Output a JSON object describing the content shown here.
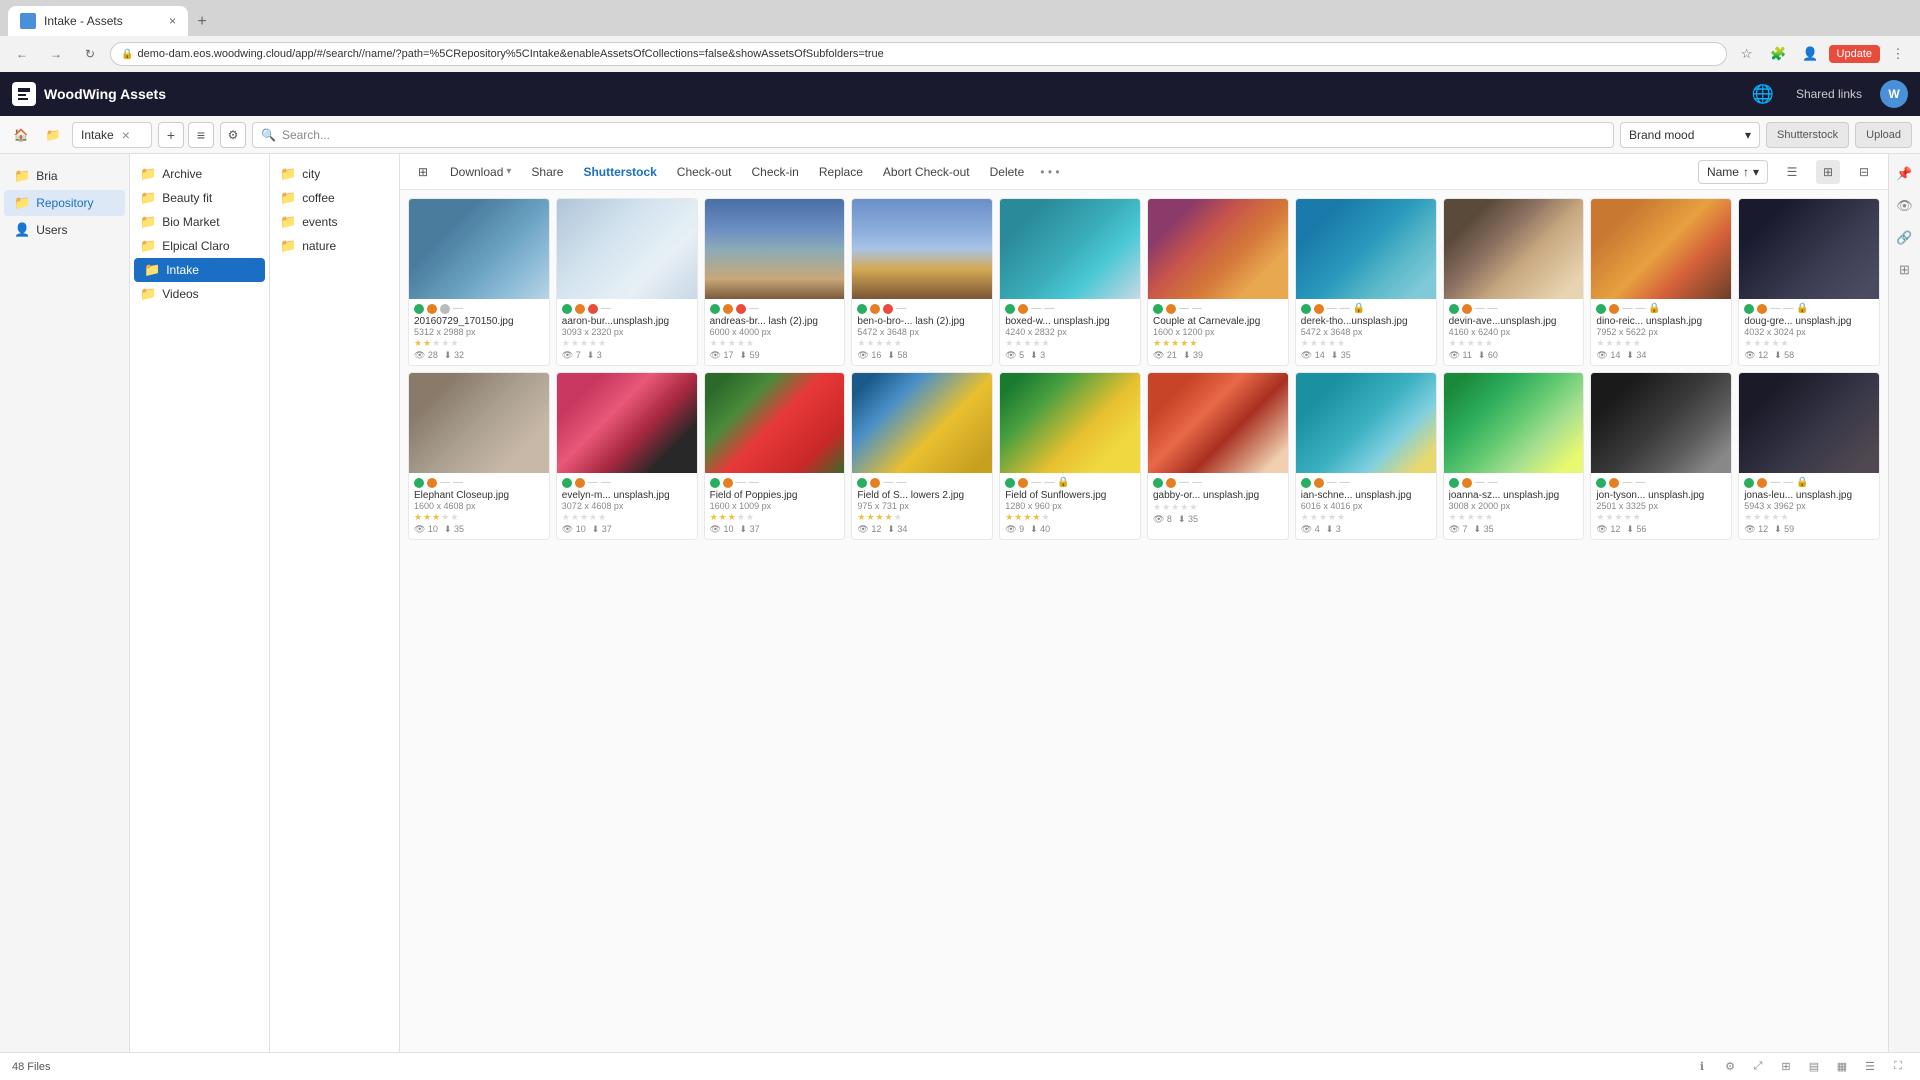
{
  "browser": {
    "tab_label": "Intake - Assets",
    "address": "demo-dam.eos.woodwing.cloud/app/#/search//name/?path=%5CRepository%5CIntake&enableAssetsOfCollections=false&showAssetsOfSubfolders=true",
    "update_btn": "Update"
  },
  "app": {
    "logo": "WoodWing Assets",
    "header_buttons": [
      "Shared links"
    ],
    "avatar_initials": "W"
  },
  "path_bar": {
    "breadcrumb": "Intake",
    "search_placeholder": "Search...",
    "collection_dropdown": "Brand mood",
    "shutterstock_btn": "Shutterstock",
    "upload_btn": "Upload"
  },
  "sidebar": {
    "items": [
      {
        "label": "Bria",
        "icon": "📁",
        "active": false
      },
      {
        "label": "Repository",
        "icon": "📁",
        "active": true
      },
      {
        "label": "Users",
        "icon": "👤",
        "active": false
      }
    ]
  },
  "folder_panel": {
    "items": [
      {
        "label": "Archive",
        "icon": "📁"
      },
      {
        "label": "Beauty fit",
        "icon": "📁"
      },
      {
        "label": "Bio Market",
        "icon": "📁"
      },
      {
        "label": "Elpical Claro",
        "icon": "📁"
      },
      {
        "label": "Intake",
        "icon": "📁",
        "active": true
      },
      {
        "label": "Videos",
        "icon": "📁"
      }
    ]
  },
  "subfolder_panel": {
    "items": [
      {
        "label": "city",
        "icon": "📁"
      },
      {
        "label": "coffee",
        "icon": "📁"
      },
      {
        "label": "events",
        "icon": "📁"
      },
      {
        "label": "nature",
        "icon": "📁"
      }
    ]
  },
  "toolbar": {
    "download_label": "Download",
    "share_label": "Share",
    "shutterstock_label": "Shutterstock",
    "checkout_label": "Check-out",
    "checkin_label": "Check-in",
    "replace_label": "Replace",
    "abort_label": "Abort Check-out",
    "delete_label": "Delete",
    "sort_label": "Name",
    "filter_label": "Filter"
  },
  "status_bar": {
    "file_count": "48 Files"
  },
  "assets": [
    {
      "name": "20160729_170150.jpg",
      "dims": "5312 x 2988 px",
      "views": 28,
      "downloads": 32,
      "stars": 2,
      "flags": [
        "green",
        "orange",
        "gray"
      ],
      "thumb": "thumb-boat"
    },
    {
      "name": "aaron-bur...unsplash.jpg",
      "dims": "3093 x 2320 px",
      "views": 7,
      "downloads": 3,
      "stars": 0,
      "flags": [
        "green",
        "orange",
        "red"
      ],
      "thumb": "thumb-snow"
    },
    {
      "name": "andreas-br... lash (2).jpg",
      "dims": "6000 x 4000 px",
      "views": 17,
      "downloads": 59,
      "stars": 0,
      "flags": [
        "green",
        "orange",
        "red"
      ],
      "thumb": "thumb-city"
    },
    {
      "name": "ben-o-bro-... lash (2).jpg",
      "dims": "5472 x 3648 px",
      "views": 16,
      "downloads": 58,
      "stars": 0,
      "flags": [
        "green",
        "orange",
        "red"
      ],
      "thumb": "thumb-skyline"
    },
    {
      "name": "boxed-w... unsplash.jpg",
      "dims": "4240 x 2832 px",
      "views": 5,
      "downloads": 3,
      "stars": 0,
      "flags": [
        "green",
        "orange"
      ],
      "thumb": "thumb-person-water"
    },
    {
      "name": "Couple at Carnevale.jpg",
      "dims": "1600 x 1200 px",
      "views": 21,
      "downloads": 39,
      "stars": 5,
      "flags": [
        "green",
        "orange"
      ],
      "thumb": "thumb-carnival"
    },
    {
      "name": "derek-tho...unsplash.jpg",
      "dims": "5472 x 3648 px",
      "views": 14,
      "downloads": 35,
      "stars": 0,
      "flags": [
        "green",
        "orange"
      ],
      "thumb": "thumb-pool",
      "badge": "🔒"
    },
    {
      "name": "devin-ave...unsplash.jpg",
      "dims": "4160 x 6240 px",
      "views": 11,
      "downloads": 60,
      "stars": 0,
      "flags": [
        "green",
        "orange"
      ],
      "thumb": "thumb-coffee"
    },
    {
      "name": "dino-reic... unsplash.jpg",
      "dims": "7952 x 5622 px",
      "views": 14,
      "downloads": 34,
      "stars": 0,
      "flags": [
        "green",
        "orange"
      ],
      "thumb": "thumb-car-canyon",
      "badge": "🔒"
    },
    {
      "name": "doug-gre... unsplash.jpg",
      "dims": "4032 x 3024 px",
      "views": 12,
      "downloads": 58,
      "stars": 0,
      "flags": [
        "green",
        "orange"
      ],
      "thumb": "thumb-dark-room",
      "badge": "🔒"
    },
    {
      "name": "Elephant Closeup.jpg",
      "dims": "1600 x 4608 px",
      "views": 10,
      "downloads": 35,
      "stars": 3,
      "flags": [
        "green",
        "orange"
      ],
      "thumb": "thumb-elephant"
    },
    {
      "name": "evelyn-m... unsplash.jpg",
      "dims": "3072 x 4608 px",
      "views": 10,
      "downloads": 37,
      "stars": 0,
      "flags": [
        "green",
        "orange"
      ],
      "thumb": "thumb-woman-flowers"
    },
    {
      "name": "Field of Poppies.jpg",
      "dims": "1600 x 1009 px",
      "views": 10,
      "downloads": 37,
      "stars": 3,
      "flags": [
        "green",
        "orange"
      ],
      "thumb": "thumb-poppies"
    },
    {
      "name": "Field of S... lowers 2.jpg",
      "dims": "975 x 731 px",
      "views": 12,
      "downloads": 34,
      "stars": 4,
      "flags": [
        "green",
        "orange"
      ],
      "thumb": "thumb-sunflower"
    },
    {
      "name": "Field of Sunflowers.jpg",
      "dims": "1280 x 960 px",
      "views": 9,
      "downloads": 40,
      "stars": 4,
      "flags": [
        "green",
        "orange"
      ],
      "thumb": "thumb-sunflowers2",
      "badge": "🔒"
    },
    {
      "name": "gabby-or... unsplash.jpg",
      "dims": "",
      "views": 8,
      "downloads": 35,
      "stars": 0,
      "flags": [
        "green",
        "orange"
      ],
      "thumb": "thumb-girl-leaf"
    },
    {
      "name": "ian-schne... unsplash.jpg",
      "dims": "6016 x 4016 px",
      "views": 4,
      "downloads": 3,
      "stars": 0,
      "flags": [
        "green",
        "orange"
      ],
      "thumb": "thumb-beach"
    },
    {
      "name": "joanna-sz... unsplash.jpg",
      "dims": "3008 x 2000 px",
      "views": 7,
      "downloads": 35,
      "stars": 0,
      "flags": [
        "green",
        "orange"
      ],
      "thumb": "thumb-palm"
    },
    {
      "name": "jon-tyson... unsplash.jpg",
      "dims": "2501 x 3325 px",
      "views": 12,
      "downloads": 56,
      "stars": 0,
      "flags": [
        "green",
        "orange"
      ],
      "thumb": "thumb-coffee-sign"
    },
    {
      "name": "jonas-leu... unsplash.jpg",
      "dims": "5943 x 3962 px",
      "views": 12,
      "downloads": 59,
      "stars": 0,
      "flags": [
        "green",
        "orange"
      ],
      "thumb": "thumb-desk",
      "badge": "🔒"
    }
  ]
}
